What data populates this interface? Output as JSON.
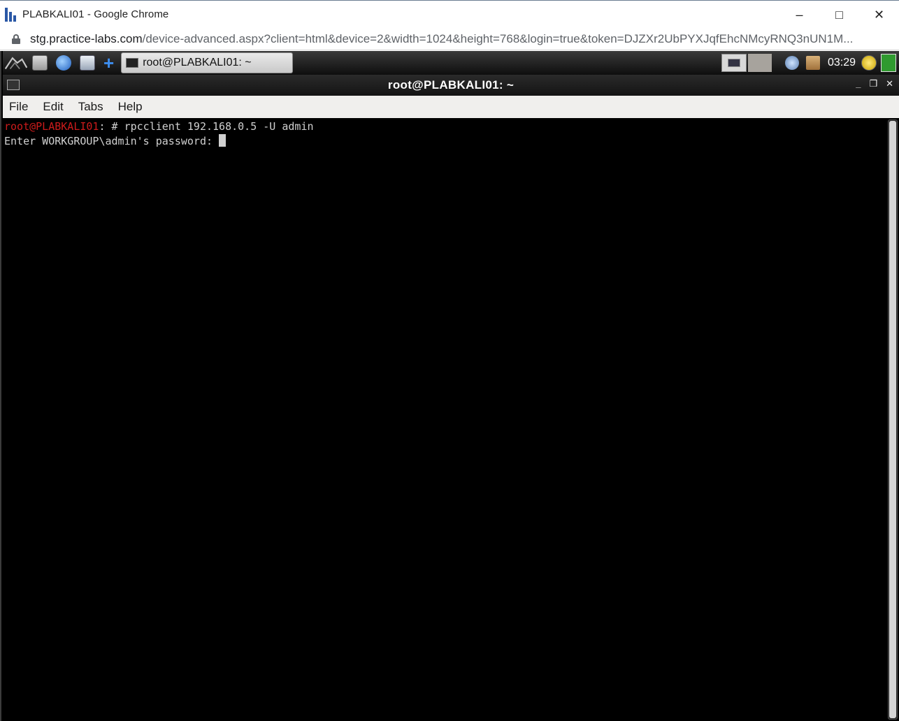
{
  "window": {
    "title": "PLABKALI01 - Google Chrome",
    "controls": {
      "minimize": "–",
      "maximize": "□",
      "close": "✕"
    }
  },
  "address": {
    "host": "stg.practice-labs.com",
    "path": "/device-advanced.aspx?client=html&device=2&width=1024&height=768&login=true&token=DJZXr2UbPYXJqfEhcNMcyRNQ3nUN1M..."
  },
  "panel": {
    "taskbar_label": "root@PLABKALI01: ~",
    "clock": "03:29"
  },
  "terminal": {
    "title": "root@PLABKALI01: ~",
    "title_controls": {
      "minimize": "_",
      "restore": "❒",
      "close": "✕"
    },
    "menu": [
      "File",
      "Edit",
      "Tabs",
      "Help"
    ],
    "prompt_user": "root@PLABKALI01",
    "prompt_rest": ": # rpcclient 192.168.0.5 -U admin",
    "output_line": "Enter WORKGROUP\\admin's password: "
  }
}
